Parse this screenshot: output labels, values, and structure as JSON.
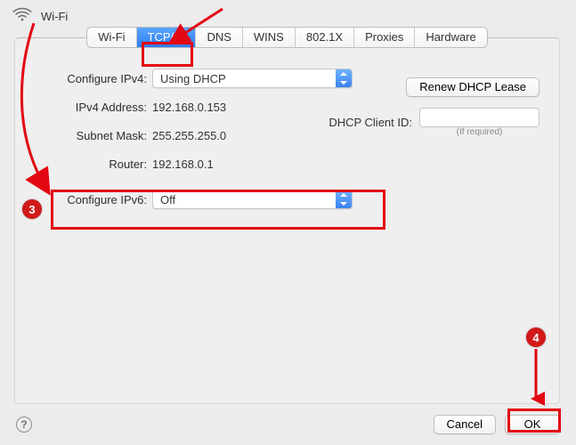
{
  "interface_name": "Wi-Fi",
  "tabs": [
    "Wi-Fi",
    "TCP/IP",
    "DNS",
    "WINS",
    "802.1X",
    "Proxies",
    "Hardware"
  ],
  "selected_tab_index": 1,
  "labels": {
    "configure_ipv4": "Configure IPv4:",
    "ipv4_address": "IPv4 Address:",
    "subnet_mask": "Subnet Mask:",
    "router": "Router:",
    "configure_ipv6": "Configure IPv6:",
    "dhcp_client_id": "DHCP Client ID:",
    "if_required": "(If required)"
  },
  "values": {
    "configure_ipv4": "Using DHCP",
    "ipv4_address": "192.168.0.153",
    "subnet_mask": "255.255.255.0",
    "router": "192.168.0.1",
    "configure_ipv6": "Off",
    "dhcp_client_id": ""
  },
  "buttons": {
    "renew_lease": "Renew DHCP Lease",
    "cancel": "Cancel",
    "ok": "OK"
  },
  "annotations": {
    "step3": "3",
    "step4": "4"
  }
}
